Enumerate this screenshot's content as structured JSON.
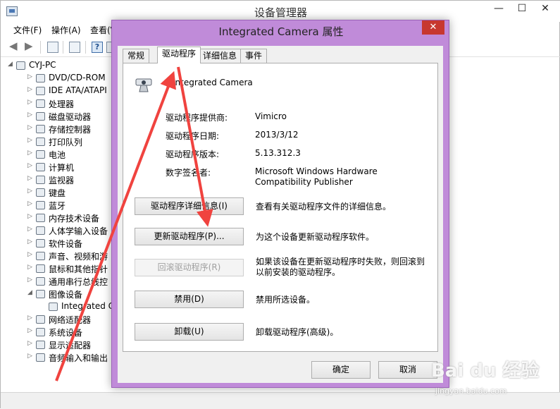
{
  "device_manager": {
    "title": "设备管理器",
    "menu": [
      "文件(F)",
      "操作(A)",
      "查看(V"
    ],
    "tree": [
      {
        "label": "CYJ-PC",
        "expanded": true,
        "level": 0
      },
      {
        "label": "DVD/CD-ROM",
        "level": 1
      },
      {
        "label": "IDE ATA/ATAPI",
        "level": 1
      },
      {
        "label": "处理器",
        "level": 1
      },
      {
        "label": "磁盘驱动器",
        "level": 1
      },
      {
        "label": "存储控制器",
        "level": 1
      },
      {
        "label": "打印队列",
        "level": 1
      },
      {
        "label": "电池",
        "level": 1
      },
      {
        "label": "计算机",
        "level": 1
      },
      {
        "label": "监视器",
        "level": 1
      },
      {
        "label": "键盘",
        "level": 1
      },
      {
        "label": "蓝牙",
        "level": 1
      },
      {
        "label": "内存技术设备",
        "level": 1
      },
      {
        "label": "人体学输入设备",
        "level": 1
      },
      {
        "label": "软件设备",
        "level": 1
      },
      {
        "label": "声音、视频和游",
        "level": 1
      },
      {
        "label": "鼠标和其他指针",
        "level": 1
      },
      {
        "label": "通用串行总线控",
        "level": 1
      },
      {
        "label": "图像设备",
        "expanded": true,
        "level": 1
      },
      {
        "label": "Integrated C",
        "level": 2
      },
      {
        "label": "网络适配器",
        "level": 1
      },
      {
        "label": "系统设备",
        "level": 1
      },
      {
        "label": "显示适配器",
        "level": 1
      },
      {
        "label": "音频输入和输出",
        "level": 1
      }
    ]
  },
  "dialog": {
    "title": "Integrated Camera 属性",
    "close_label": "✕",
    "tabs": [
      "常规",
      "驱动程序",
      "详细信息",
      "事件"
    ],
    "active_tab": "驱动程序",
    "device_name": "Integrated Camera",
    "info": [
      {
        "label": "驱动程序提供商:",
        "value": "Vimicro"
      },
      {
        "label": "驱动程序日期:",
        "value": "2013/3/12"
      },
      {
        "label": "驱动程序版本:",
        "value": "5.13.312.3"
      },
      {
        "label": "数字签名者:",
        "value": "Microsoft Windows Hardware Compatibility Publisher"
      }
    ],
    "actions": [
      {
        "button": "驱动程序详细信息(I)",
        "description": "查看有关驱动程序文件的详细信息。",
        "enabled": true
      },
      {
        "button": "更新驱动程序(P)...",
        "description": "为这个设备更新驱动程序软件。",
        "enabled": true
      },
      {
        "button": "回滚驱动程序(R)",
        "description": "如果该设备在更新驱动程序时失败，则回滚到以前安装的驱动程序。",
        "enabled": false
      },
      {
        "button": "禁用(D)",
        "description": "禁用所选设备。",
        "enabled": true
      },
      {
        "button": "卸载(U)",
        "description": "卸载驱动程序(高级)。",
        "enabled": true
      }
    ],
    "ok_label": "确定",
    "cancel_label": "取消"
  },
  "watermark": {
    "brand": "Bai du 经验",
    "url": "jingyan.baidu.com"
  },
  "colors": {
    "dialog_frame": "#c08bd9",
    "annotation_arrow": "#f0433f",
    "close_button": "#c7372f"
  }
}
